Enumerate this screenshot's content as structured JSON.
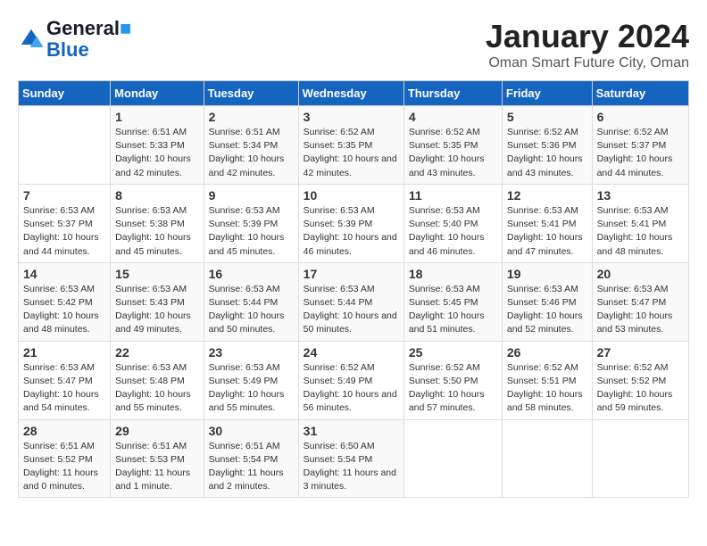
{
  "logo": {
    "line1": "General",
    "line2": "Blue"
  },
  "title": "January 2024",
  "subtitle": "Oman Smart Future City, Oman",
  "days_header": [
    "Sunday",
    "Monday",
    "Tuesday",
    "Wednesday",
    "Thursday",
    "Friday",
    "Saturday"
  ],
  "weeks": [
    [
      {
        "num": "",
        "sunrise": "",
        "sunset": "",
        "daylight": ""
      },
      {
        "num": "1",
        "sunrise": "Sunrise: 6:51 AM",
        "sunset": "Sunset: 5:33 PM",
        "daylight": "Daylight: 10 hours and 42 minutes."
      },
      {
        "num": "2",
        "sunrise": "Sunrise: 6:51 AM",
        "sunset": "Sunset: 5:34 PM",
        "daylight": "Daylight: 10 hours and 42 minutes."
      },
      {
        "num": "3",
        "sunrise": "Sunrise: 6:52 AM",
        "sunset": "Sunset: 5:35 PM",
        "daylight": "Daylight: 10 hours and 42 minutes."
      },
      {
        "num": "4",
        "sunrise": "Sunrise: 6:52 AM",
        "sunset": "Sunset: 5:35 PM",
        "daylight": "Daylight: 10 hours and 43 minutes."
      },
      {
        "num": "5",
        "sunrise": "Sunrise: 6:52 AM",
        "sunset": "Sunset: 5:36 PM",
        "daylight": "Daylight: 10 hours and 43 minutes."
      },
      {
        "num": "6",
        "sunrise": "Sunrise: 6:52 AM",
        "sunset": "Sunset: 5:37 PM",
        "daylight": "Daylight: 10 hours and 44 minutes."
      }
    ],
    [
      {
        "num": "7",
        "sunrise": "Sunrise: 6:53 AM",
        "sunset": "Sunset: 5:37 PM",
        "daylight": "Daylight: 10 hours and 44 minutes."
      },
      {
        "num": "8",
        "sunrise": "Sunrise: 6:53 AM",
        "sunset": "Sunset: 5:38 PM",
        "daylight": "Daylight: 10 hours and 45 minutes."
      },
      {
        "num": "9",
        "sunrise": "Sunrise: 6:53 AM",
        "sunset": "Sunset: 5:39 PM",
        "daylight": "Daylight: 10 hours and 45 minutes."
      },
      {
        "num": "10",
        "sunrise": "Sunrise: 6:53 AM",
        "sunset": "Sunset: 5:39 PM",
        "daylight": "Daylight: 10 hours and 46 minutes."
      },
      {
        "num": "11",
        "sunrise": "Sunrise: 6:53 AM",
        "sunset": "Sunset: 5:40 PM",
        "daylight": "Daylight: 10 hours and 46 minutes."
      },
      {
        "num": "12",
        "sunrise": "Sunrise: 6:53 AM",
        "sunset": "Sunset: 5:41 PM",
        "daylight": "Daylight: 10 hours and 47 minutes."
      },
      {
        "num": "13",
        "sunrise": "Sunrise: 6:53 AM",
        "sunset": "Sunset: 5:41 PM",
        "daylight": "Daylight: 10 hours and 48 minutes."
      }
    ],
    [
      {
        "num": "14",
        "sunrise": "Sunrise: 6:53 AM",
        "sunset": "Sunset: 5:42 PM",
        "daylight": "Daylight: 10 hours and 48 minutes."
      },
      {
        "num": "15",
        "sunrise": "Sunrise: 6:53 AM",
        "sunset": "Sunset: 5:43 PM",
        "daylight": "Daylight: 10 hours and 49 minutes."
      },
      {
        "num": "16",
        "sunrise": "Sunrise: 6:53 AM",
        "sunset": "Sunset: 5:44 PM",
        "daylight": "Daylight: 10 hours and 50 minutes."
      },
      {
        "num": "17",
        "sunrise": "Sunrise: 6:53 AM",
        "sunset": "Sunset: 5:44 PM",
        "daylight": "Daylight: 10 hours and 50 minutes."
      },
      {
        "num": "18",
        "sunrise": "Sunrise: 6:53 AM",
        "sunset": "Sunset: 5:45 PM",
        "daylight": "Daylight: 10 hours and 51 minutes."
      },
      {
        "num": "19",
        "sunrise": "Sunrise: 6:53 AM",
        "sunset": "Sunset: 5:46 PM",
        "daylight": "Daylight: 10 hours and 52 minutes."
      },
      {
        "num": "20",
        "sunrise": "Sunrise: 6:53 AM",
        "sunset": "Sunset: 5:47 PM",
        "daylight": "Daylight: 10 hours and 53 minutes."
      }
    ],
    [
      {
        "num": "21",
        "sunrise": "Sunrise: 6:53 AM",
        "sunset": "Sunset: 5:47 PM",
        "daylight": "Daylight: 10 hours and 54 minutes."
      },
      {
        "num": "22",
        "sunrise": "Sunrise: 6:53 AM",
        "sunset": "Sunset: 5:48 PM",
        "daylight": "Daylight: 10 hours and 55 minutes."
      },
      {
        "num": "23",
        "sunrise": "Sunrise: 6:53 AM",
        "sunset": "Sunset: 5:49 PM",
        "daylight": "Daylight: 10 hours and 55 minutes."
      },
      {
        "num": "24",
        "sunrise": "Sunrise: 6:52 AM",
        "sunset": "Sunset: 5:49 PM",
        "daylight": "Daylight: 10 hours and 56 minutes."
      },
      {
        "num": "25",
        "sunrise": "Sunrise: 6:52 AM",
        "sunset": "Sunset: 5:50 PM",
        "daylight": "Daylight: 10 hours and 57 minutes."
      },
      {
        "num": "26",
        "sunrise": "Sunrise: 6:52 AM",
        "sunset": "Sunset: 5:51 PM",
        "daylight": "Daylight: 10 hours and 58 minutes."
      },
      {
        "num": "27",
        "sunrise": "Sunrise: 6:52 AM",
        "sunset": "Sunset: 5:52 PM",
        "daylight": "Daylight: 10 hours and 59 minutes."
      }
    ],
    [
      {
        "num": "28",
        "sunrise": "Sunrise: 6:51 AM",
        "sunset": "Sunset: 5:52 PM",
        "daylight": "Daylight: 11 hours and 0 minutes."
      },
      {
        "num": "29",
        "sunrise": "Sunrise: 6:51 AM",
        "sunset": "Sunset: 5:53 PM",
        "daylight": "Daylight: 11 hours and 1 minute."
      },
      {
        "num": "30",
        "sunrise": "Sunrise: 6:51 AM",
        "sunset": "Sunset: 5:54 PM",
        "daylight": "Daylight: 11 hours and 2 minutes."
      },
      {
        "num": "31",
        "sunrise": "Sunrise: 6:50 AM",
        "sunset": "Sunset: 5:54 PM",
        "daylight": "Daylight: 11 hours and 3 minutes."
      },
      {
        "num": "",
        "sunrise": "",
        "sunset": "",
        "daylight": ""
      },
      {
        "num": "",
        "sunrise": "",
        "sunset": "",
        "daylight": ""
      },
      {
        "num": "",
        "sunrise": "",
        "sunset": "",
        "daylight": ""
      }
    ]
  ]
}
